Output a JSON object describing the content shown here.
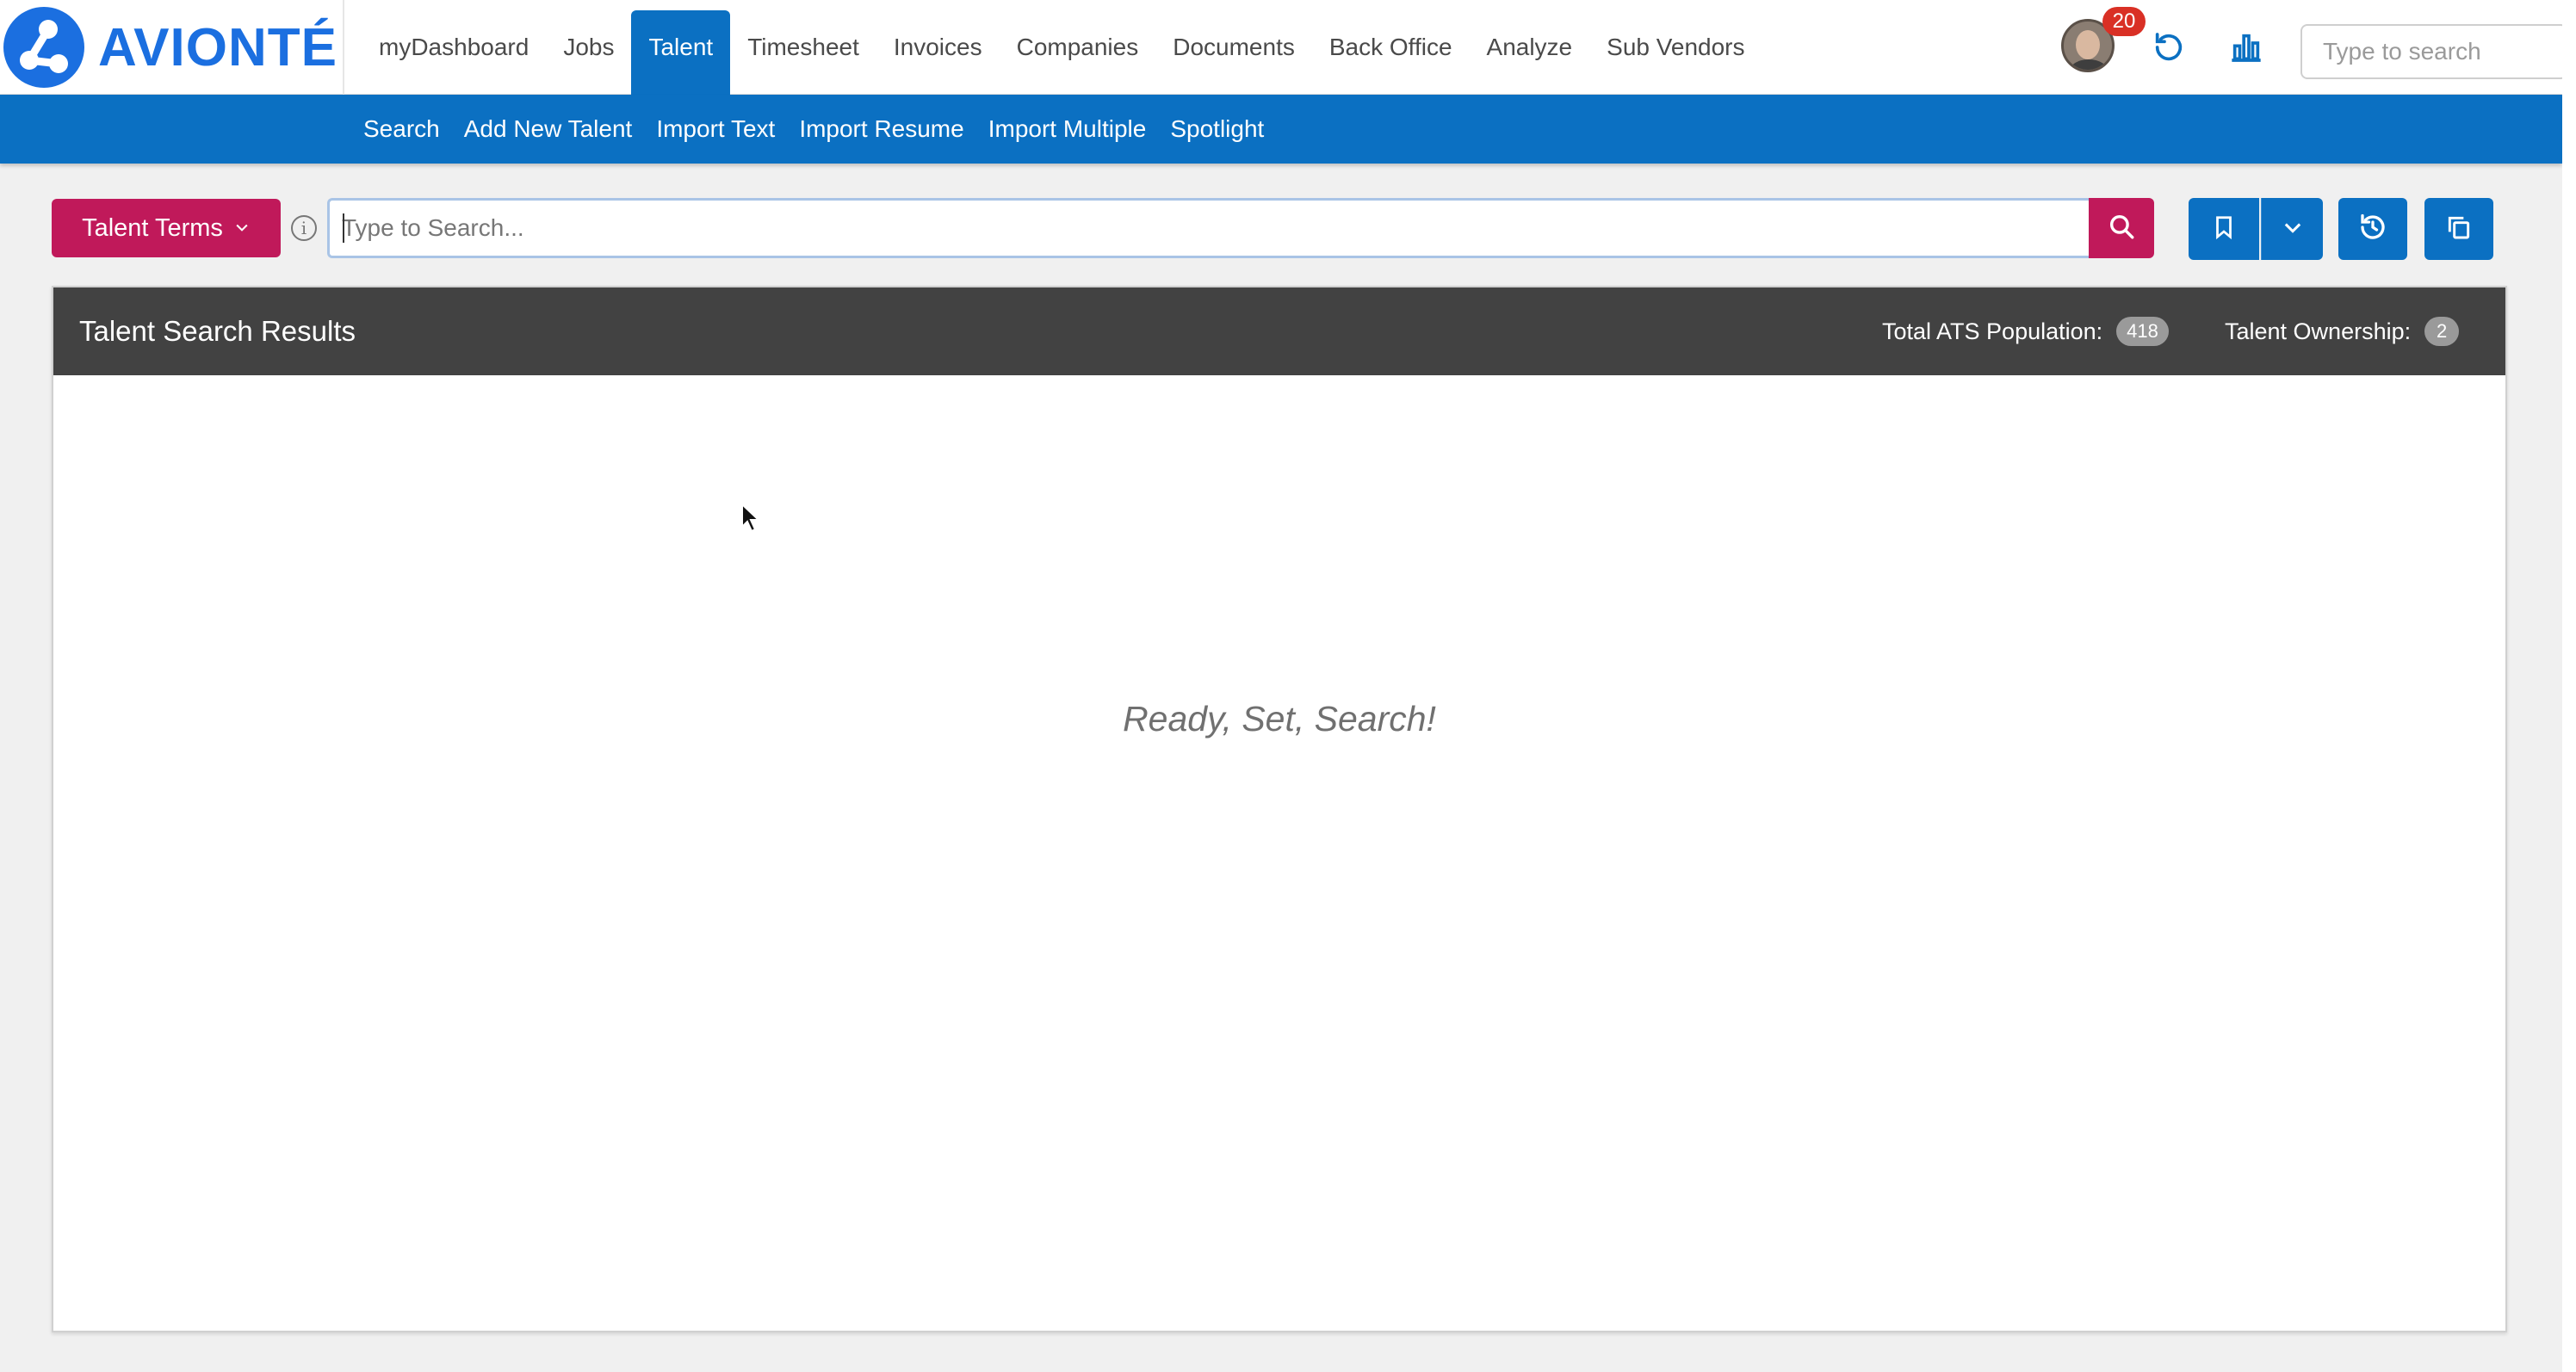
{
  "app": {
    "logo_text": "AVIONTÉ",
    "brand_color": "#1b6fe0",
    "accent_blue": "#0b70c2",
    "accent_magenta": "#c0195a"
  },
  "nav": {
    "items": [
      {
        "label": "myDashboard",
        "name": "nav-item-mydashboard",
        "active": false
      },
      {
        "label": "Jobs",
        "name": "nav-item-jobs",
        "active": false
      },
      {
        "label": "Talent",
        "name": "nav-item-talent",
        "active": true
      },
      {
        "label": "Timesheet",
        "name": "nav-item-timesheet",
        "active": false
      },
      {
        "label": "Invoices",
        "name": "nav-item-invoices",
        "active": false
      },
      {
        "label": "Companies",
        "name": "nav-item-companies",
        "active": false
      },
      {
        "label": "Documents",
        "name": "nav-item-documents",
        "active": false
      },
      {
        "label": "Back Office",
        "name": "nav-item-back-office",
        "active": false
      },
      {
        "label": "Analyze",
        "name": "nav-item-analyze",
        "active": false
      },
      {
        "label": "Sub Vendors",
        "name": "nav-item-sub-vendors",
        "active": false
      }
    ]
  },
  "top_right": {
    "notification_count": "20",
    "global_search_placeholder": "Type to search",
    "icons": [
      "avatar",
      "refresh-icon",
      "bar-chart-icon"
    ]
  },
  "subnav": {
    "items": [
      {
        "label": "Search",
        "name": "subnav-item-search"
      },
      {
        "label": "Add New Talent",
        "name": "subnav-item-add-new-talent"
      },
      {
        "label": "Import Text",
        "name": "subnav-item-import-text"
      },
      {
        "label": "Import Resume",
        "name": "subnav-item-import-resume"
      },
      {
        "label": "Import Multiple",
        "name": "subnav-item-import-multiple"
      },
      {
        "label": "Spotlight",
        "name": "subnav-item-spotlight"
      }
    ]
  },
  "search": {
    "terms_label": "Talent Terms",
    "placeholder": "Type to Search...",
    "value": "",
    "toolbar_icons": [
      "search-icon",
      "bookmark-icon",
      "chevron-down-icon",
      "history-icon",
      "copy-icon"
    ]
  },
  "results": {
    "title": "Talent Search Results",
    "ats_label": "Total ATS Population:",
    "ats_count": "418",
    "ownership_label": "Talent Ownership:",
    "ownership_count": "2",
    "empty_message": "Ready, Set, Search!"
  }
}
